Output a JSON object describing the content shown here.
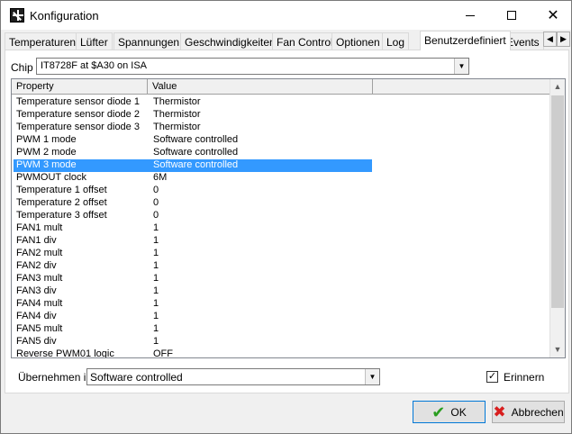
{
  "window": {
    "title": "Konfiguration"
  },
  "tabs": [
    {
      "label": "Temperaturen"
    },
    {
      "label": "Lüfter"
    },
    {
      "label": "Spannungen"
    },
    {
      "label": "Geschwindigkeiten"
    },
    {
      "label": "Fan Control"
    },
    {
      "label": "Optionen"
    },
    {
      "label": "Log"
    },
    {
      "label": "Benutzerdefiniert"
    },
    {
      "label": "Events"
    }
  ],
  "chip": {
    "label": "Chip",
    "value": "IT8728F at $A30 on ISA"
  },
  "grid": {
    "headers": {
      "property": "Property",
      "value": "Value"
    },
    "rows": [
      {
        "property": "Temperature sensor diode 1",
        "value": "Thermistor"
      },
      {
        "property": "Temperature sensor diode 2",
        "value": "Thermistor"
      },
      {
        "property": "Temperature sensor diode 3",
        "value": "Thermistor"
      },
      {
        "property": "PWM 1 mode",
        "value": "Software controlled"
      },
      {
        "property": "PWM 2 mode",
        "value": "Software controlled"
      },
      {
        "property": "PWM 3 mode",
        "value": "Software controlled"
      },
      {
        "property": "PWMOUT clock",
        "value": "6M"
      },
      {
        "property": "Temperature 1 offset",
        "value": "0"
      },
      {
        "property": "Temperature 2 offset",
        "value": "0"
      },
      {
        "property": "Temperature 3 offset",
        "value": "0"
      },
      {
        "property": "FAN1 mult",
        "value": "1"
      },
      {
        "property": "FAN1 div",
        "value": "1"
      },
      {
        "property": "FAN2 mult",
        "value": "1"
      },
      {
        "property": "FAN2 div",
        "value": "1"
      },
      {
        "property": "FAN3 mult",
        "value": "1"
      },
      {
        "property": "FAN3 div",
        "value": "1"
      },
      {
        "property": "FAN4 mult",
        "value": "1"
      },
      {
        "property": "FAN4 div",
        "value": "1"
      },
      {
        "property": "FAN5 mult",
        "value": "1"
      },
      {
        "property": "FAN5 div",
        "value": "1"
      },
      {
        "property": "Reverse PWM01 logic",
        "value": "OFF"
      }
    ],
    "selected_row": "PWM 3 mode"
  },
  "apply": {
    "label": "Übernehmen in",
    "value": "Software controlled"
  },
  "remember": {
    "label": "Erinnern",
    "checked": true
  },
  "buttons": {
    "ok": "OK",
    "cancel": "Abbrechen"
  },
  "colors": {
    "selection": "#3399ff",
    "ok_icon": "#2a9d20",
    "cancel_icon": "#d81e1e"
  },
  "icons": {
    "app": "fan-icon",
    "ok": "checkmark-icon",
    "cancel": "x-icon"
  }
}
